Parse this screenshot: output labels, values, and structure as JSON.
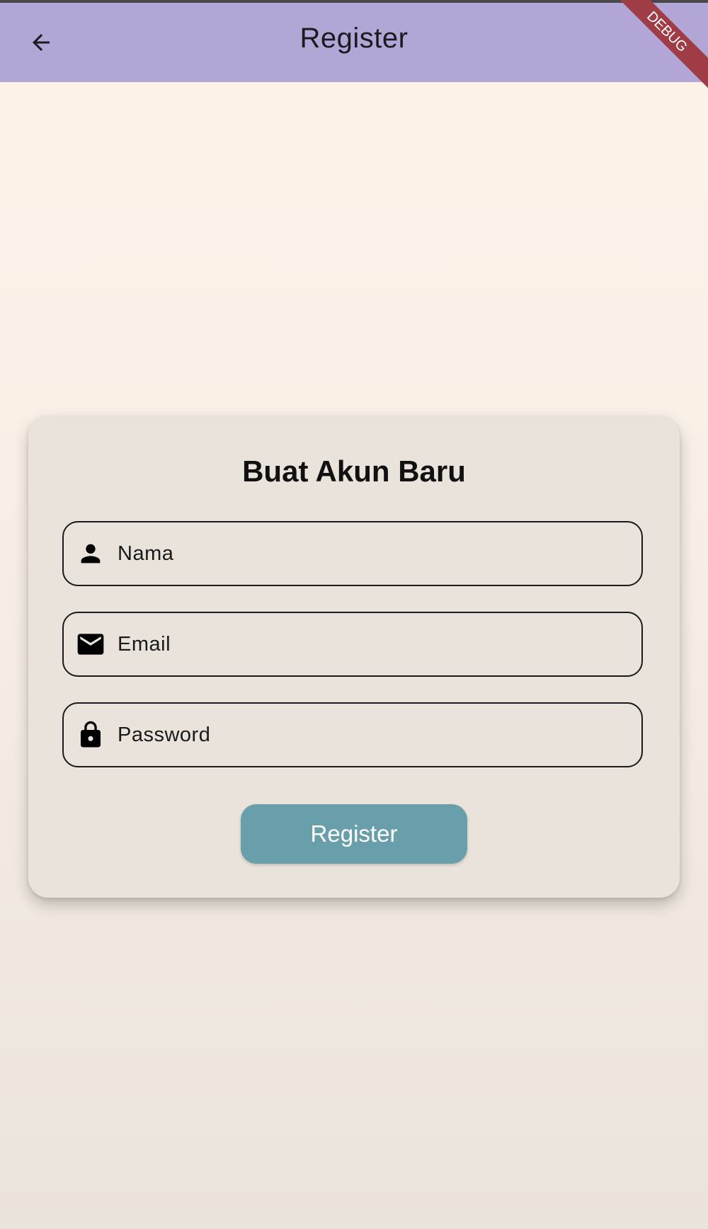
{
  "app_bar": {
    "title": "Register",
    "back_icon": "arrow-back-icon",
    "debug_banner": "DEBUG",
    "background": "#b1a6d5"
  },
  "card": {
    "title": "Buat Akun Baru",
    "fields": [
      {
        "icon": "person-icon",
        "placeholder": "Nama",
        "value": ""
      },
      {
        "icon": "mail-icon",
        "placeholder": "Email",
        "value": ""
      },
      {
        "icon": "lock-icon",
        "placeholder": "Password",
        "value": ""
      }
    ],
    "submit_label": "Register",
    "submit_color": "#699eab"
  }
}
